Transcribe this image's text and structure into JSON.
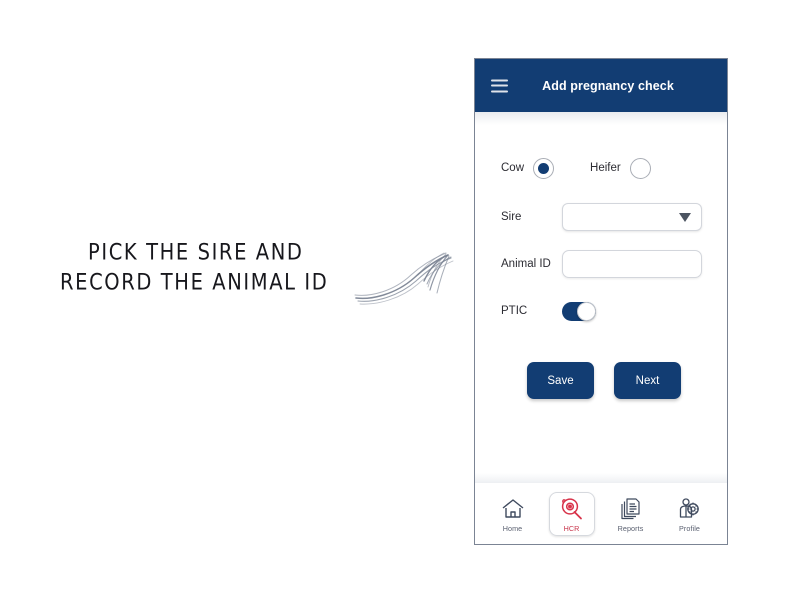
{
  "annotation": {
    "line1": "PICK THE SIRE AND",
    "line2": "RECORD THE ANIMAL ID",
    "arrow_icon": "curved-sketch-arrow-up-right"
  },
  "phone": {
    "app_bar": {
      "menu_icon": "hamburger-menu-icon",
      "title": "Add pregnancy check",
      "background_color": "#123d73",
      "title_color": "#ffffff"
    },
    "form": {
      "animal_type": {
        "options": [
          {
            "label": "Cow",
            "selected": true
          },
          {
            "label": "Heifer",
            "selected": false
          }
        ],
        "selected_value": "Cow",
        "selected_color": "#123d73"
      },
      "sire": {
        "label": "Sire",
        "value": "",
        "placeholder": "",
        "caret_icon": "chevron-down-icon"
      },
      "animal_id": {
        "label": "Animal ID",
        "value": "",
        "placeholder": ""
      },
      "ptic": {
        "label": "PTIC",
        "state": "on",
        "on_color": "#123d73"
      }
    },
    "actions": {
      "save_label": "Save",
      "next_label": "Next",
      "button_color": "#123d73"
    },
    "bottom_nav": {
      "items": [
        {
          "label": "Home",
          "icon": "home-icon",
          "selected": false
        },
        {
          "label": "HCR",
          "icon": "magnifier-cow-icon",
          "selected": true
        },
        {
          "label": "Reports",
          "icon": "documents-stack-icon",
          "selected": false
        },
        {
          "label": "Profile",
          "icon": "person-gear-icon",
          "selected": false
        }
      ],
      "selected_label": "HCR",
      "selected_color": "#c8334a"
    }
  }
}
